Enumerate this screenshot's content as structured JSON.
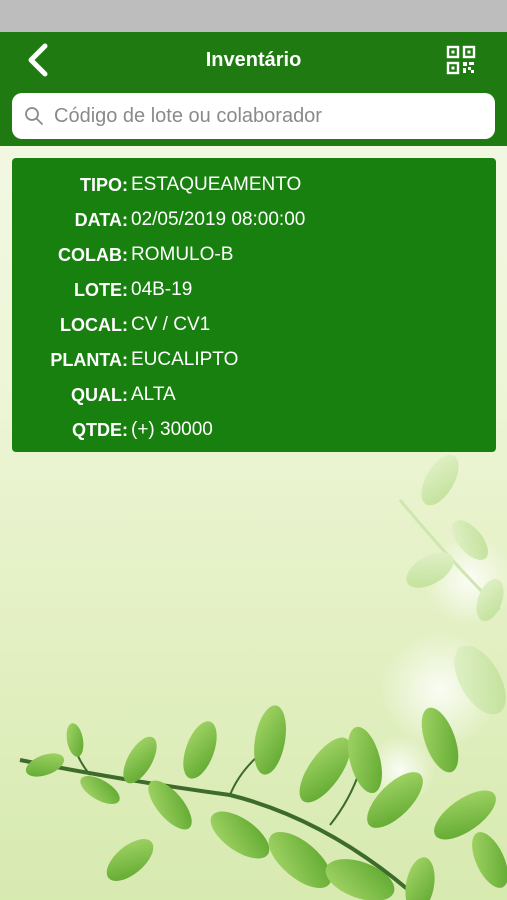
{
  "header": {
    "title": "Inventário",
    "back_icon": "chevron-left-icon",
    "qr_icon": "qr-code-icon"
  },
  "search": {
    "placeholder": "Código de lote ou colaborador",
    "value": ""
  },
  "record": {
    "fields": [
      {
        "label": "TIPO:",
        "value": "ESTAQUEAMENTO"
      },
      {
        "label": "DATA:",
        "value": "02/05/2019 08:00:00"
      },
      {
        "label": "COLAB:",
        "value": "ROMULO-B"
      },
      {
        "label": "LOTE:",
        "value": "04B-19"
      },
      {
        "label": "LOCAL:",
        "value": "CV / CV1"
      },
      {
        "label": "PLANTA:",
        "value": "EUCALIPTO"
      },
      {
        "label": "QUAL:",
        "value": "ALTA"
      },
      {
        "label": "QTDE:",
        "value": "(+) 30000"
      }
    ]
  },
  "colors": {
    "primary": "#1f7a12",
    "card": "#18800e",
    "status_bar": "#bdbdbd",
    "leaf": "#7cc242"
  }
}
